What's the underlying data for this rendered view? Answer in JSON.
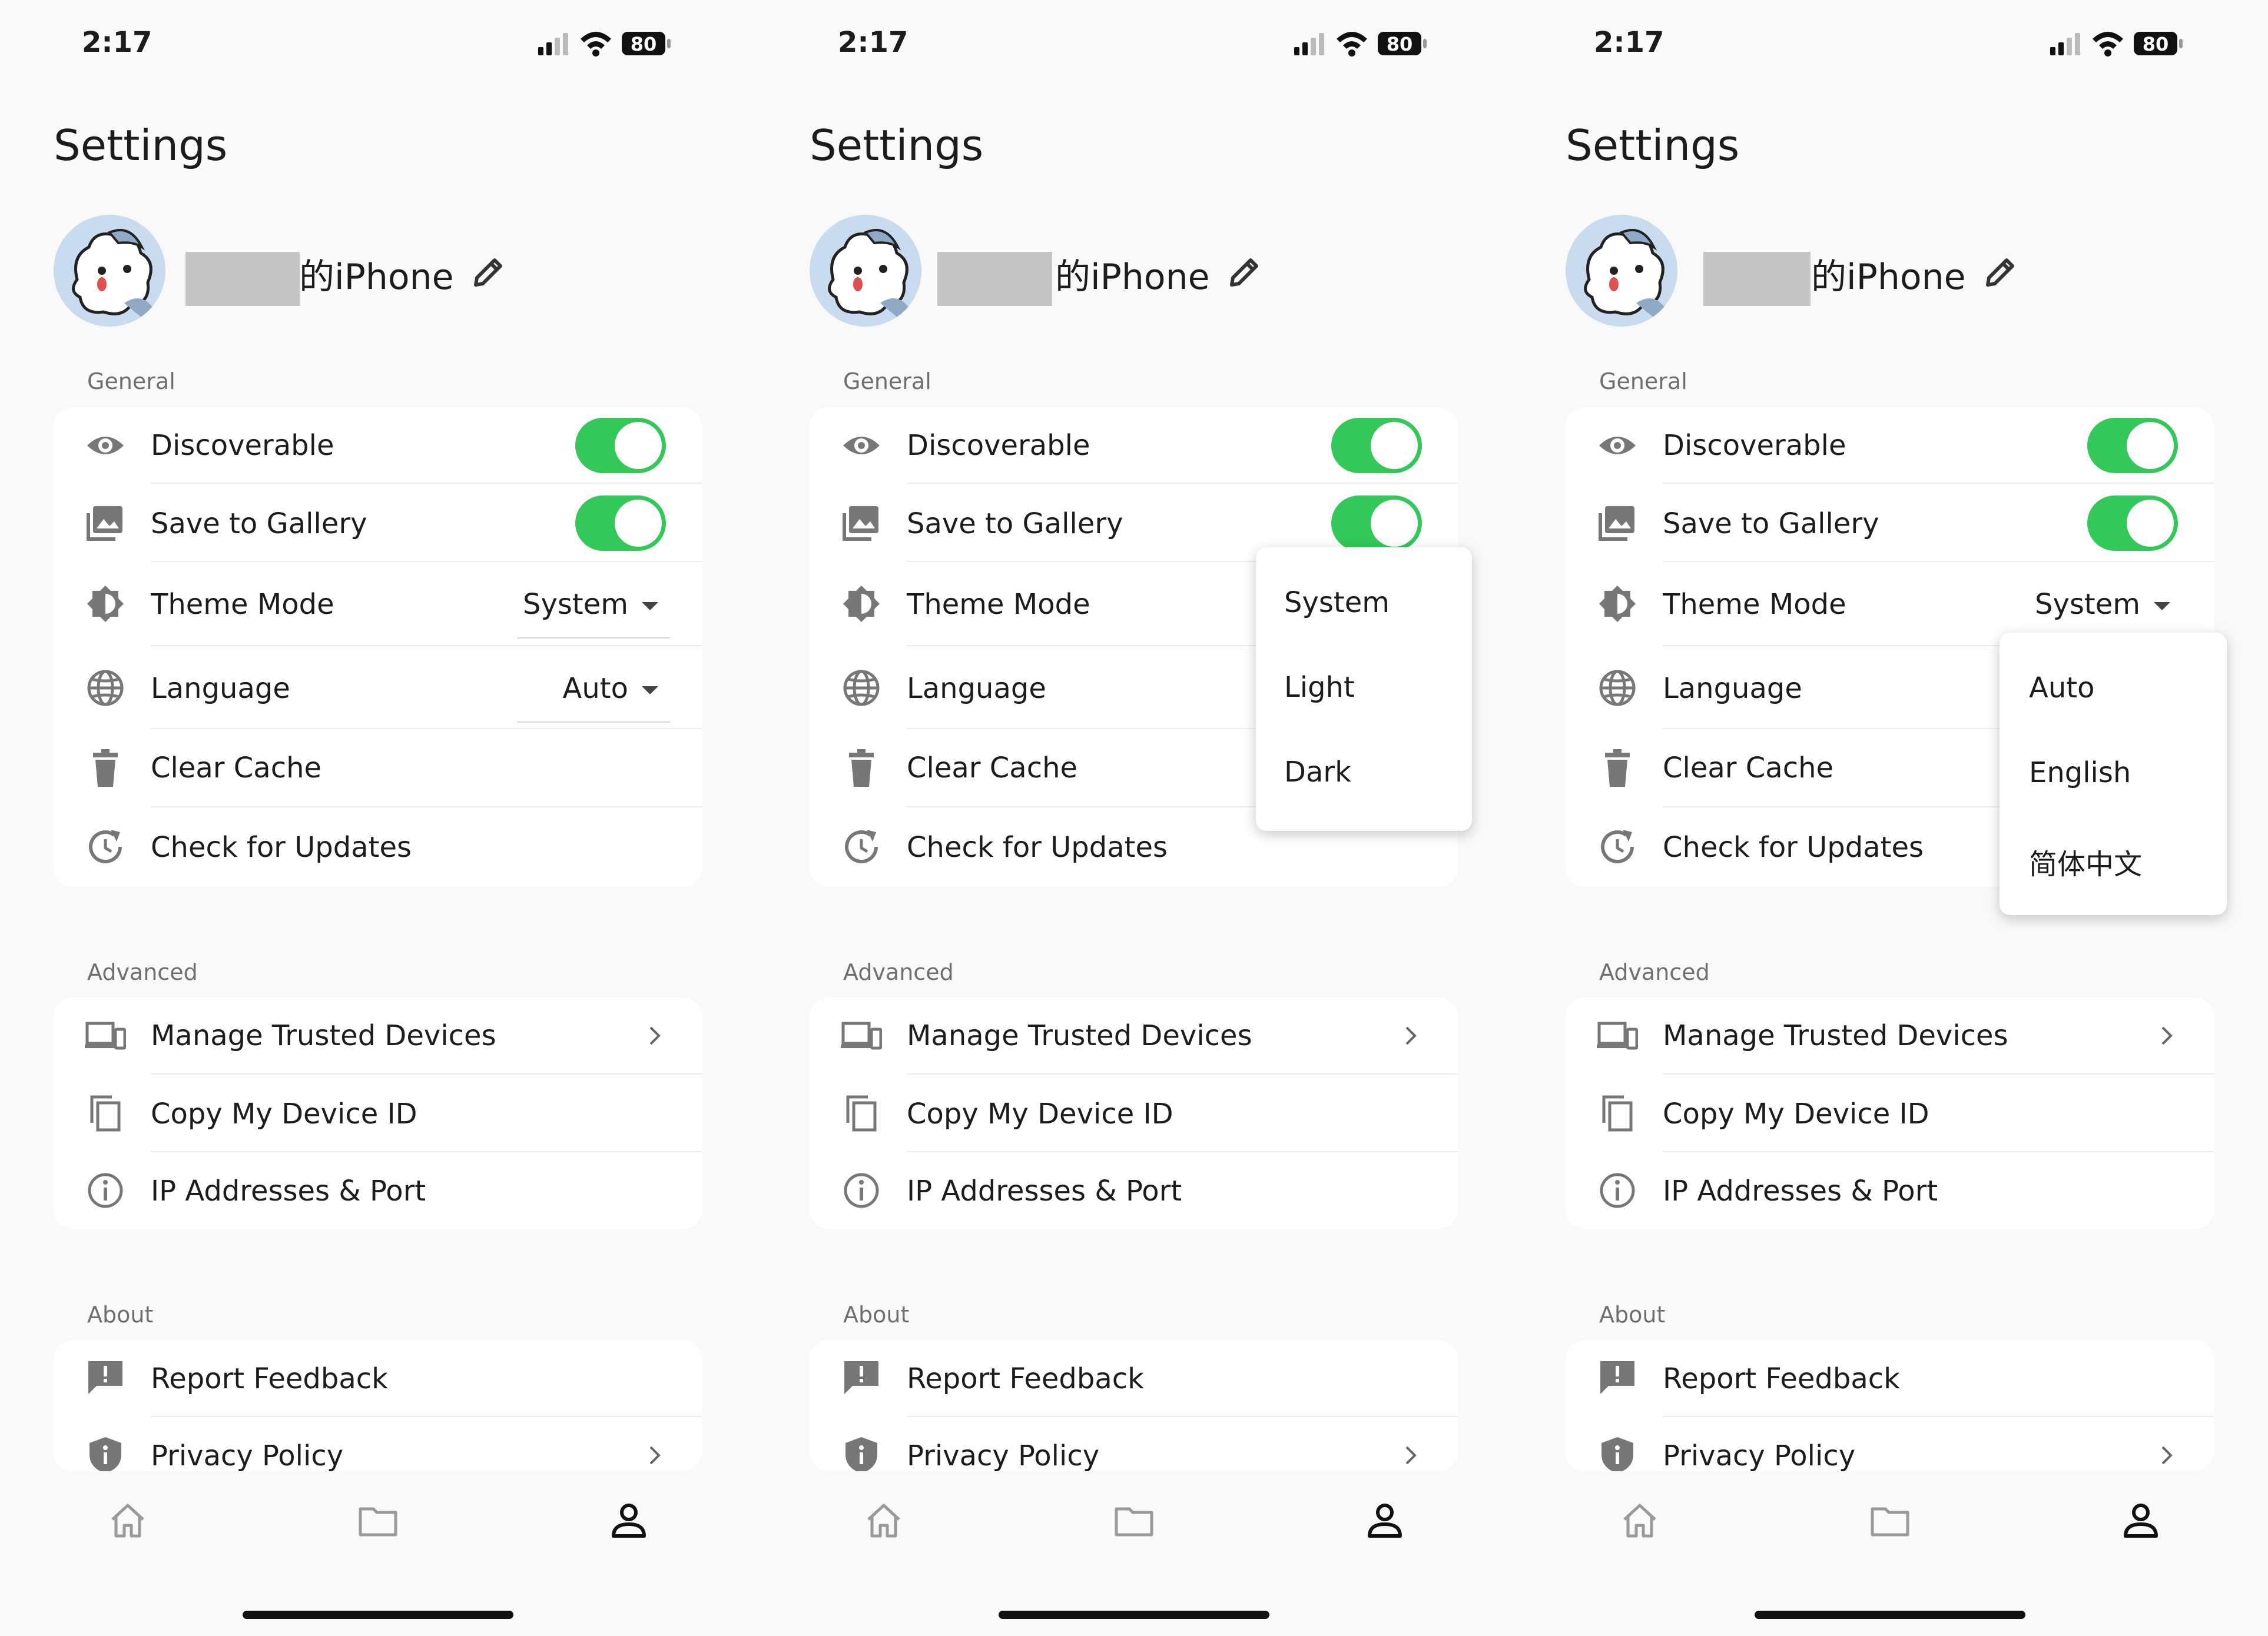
{
  "screens": [
    {
      "status": {
        "time": "2:17",
        "battery": "80"
      },
      "title": "Settings",
      "device_name": "的iPhone",
      "sections": {
        "general": "General",
        "advanced": "Advanced",
        "about": "About"
      },
      "general": {
        "discoverable": {
          "label": "Discoverable",
          "on": true
        },
        "save_to_gallery": {
          "label": "Save to Gallery",
          "on": true
        },
        "theme_mode": {
          "label": "Theme Mode",
          "value": "System"
        },
        "language": {
          "label": "Language",
          "value": "Auto"
        },
        "clear_cache": "Clear Cache",
        "check_updates": "Check for Updates"
      },
      "advanced": {
        "trusted_devices": "Manage Trusted Devices",
        "copy_id": "Copy My Device ID",
        "ip_port": "IP Addresses & Port"
      },
      "about": {
        "feedback": "Report Feedback",
        "privacy": "Privacy Policy"
      }
    },
    {
      "status": {
        "time": "2:17",
        "battery": "80"
      },
      "title": "Settings",
      "device_name": "的iPhone",
      "sections": {
        "general": "General",
        "advanced": "Advanced",
        "about": "About"
      },
      "general": {
        "discoverable": {
          "label": "Discoverable",
          "on": true
        },
        "save_to_gallery": {
          "label": "Save to Gallery",
          "on": true
        },
        "theme_mode": {
          "label": "Theme Mode"
        },
        "language": {
          "label": "Language"
        },
        "clear_cache": "Clear Cache",
        "check_updates": "Check for Updates"
      },
      "theme_menu": {
        "options": [
          "System",
          "Light",
          "Dark"
        ]
      },
      "advanced": {
        "trusted_devices": "Manage Trusted Devices",
        "copy_id": "Copy My Device ID",
        "ip_port": "IP Addresses & Port"
      },
      "about": {
        "feedback": "Report Feedback",
        "privacy": "Privacy Policy"
      }
    },
    {
      "status": {
        "time": "2:17",
        "battery": "80"
      },
      "title": "Settings",
      "device_name": "的iPhone",
      "sections": {
        "general": "General",
        "advanced": "Advanced",
        "about": "About"
      },
      "general": {
        "discoverable": {
          "label": "Discoverable",
          "on": true
        },
        "save_to_gallery": {
          "label": "Save to Gallery",
          "on": true
        },
        "theme_mode": {
          "label": "Theme Mode",
          "value": "System"
        },
        "language": {
          "label": "Language"
        },
        "clear_cache": "Clear Cache",
        "check_updates": "Check for Updates"
      },
      "language_menu": {
        "options": [
          "Auto",
          "English",
          "简体中文"
        ]
      },
      "advanced": {
        "trusted_devices": "Manage Trusted Devices",
        "copy_id": "Copy My Device ID",
        "ip_port": "IP Addresses & Port"
      },
      "about": {
        "feedback": "Report Feedback",
        "privacy": "Privacy Policy"
      }
    }
  ],
  "nav": {
    "items": [
      "home-icon",
      "folder-icon",
      "person-icon"
    ],
    "active": "person-icon"
  },
  "colors": {
    "toggle_on": "#34c759",
    "background": "#f9f9f9",
    "card": "#ffffff",
    "section_label": "#6e6e6e"
  }
}
